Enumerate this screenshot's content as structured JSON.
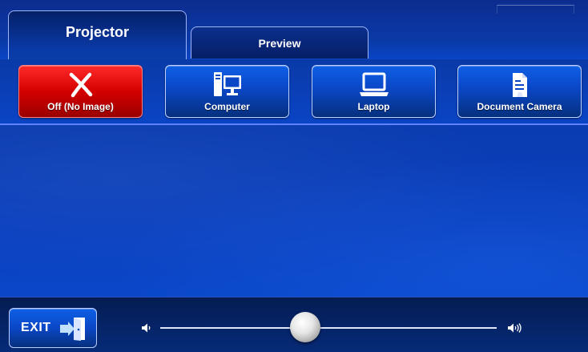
{
  "tabs": [
    {
      "label": "Projector",
      "active": true
    },
    {
      "label": "Preview",
      "active": false
    }
  ],
  "sources": [
    {
      "label": "Off (No Image)",
      "icon": "close-x-icon",
      "color": "#d90000"
    },
    {
      "label": "Computer",
      "icon": "computer-icon",
      "color": "#0a47c6"
    },
    {
      "label": "Laptop",
      "icon": "laptop-icon",
      "color": "#0a47c6"
    },
    {
      "label": "Document Camera",
      "icon": "document-camera-icon",
      "color": "#0a47c6"
    }
  ],
  "footer": {
    "exit_label": "EXIT",
    "exit_icon": "exit-door-icon",
    "volume": {
      "level": 0.43,
      "min_icon": "volume-low-icon",
      "max_icon": "volume-high-icon"
    }
  },
  "colors": {
    "background": "#0a3bb0",
    "button_blue": "#0a47c6",
    "button_red": "#d90000",
    "outline": "#bcd0ff"
  }
}
